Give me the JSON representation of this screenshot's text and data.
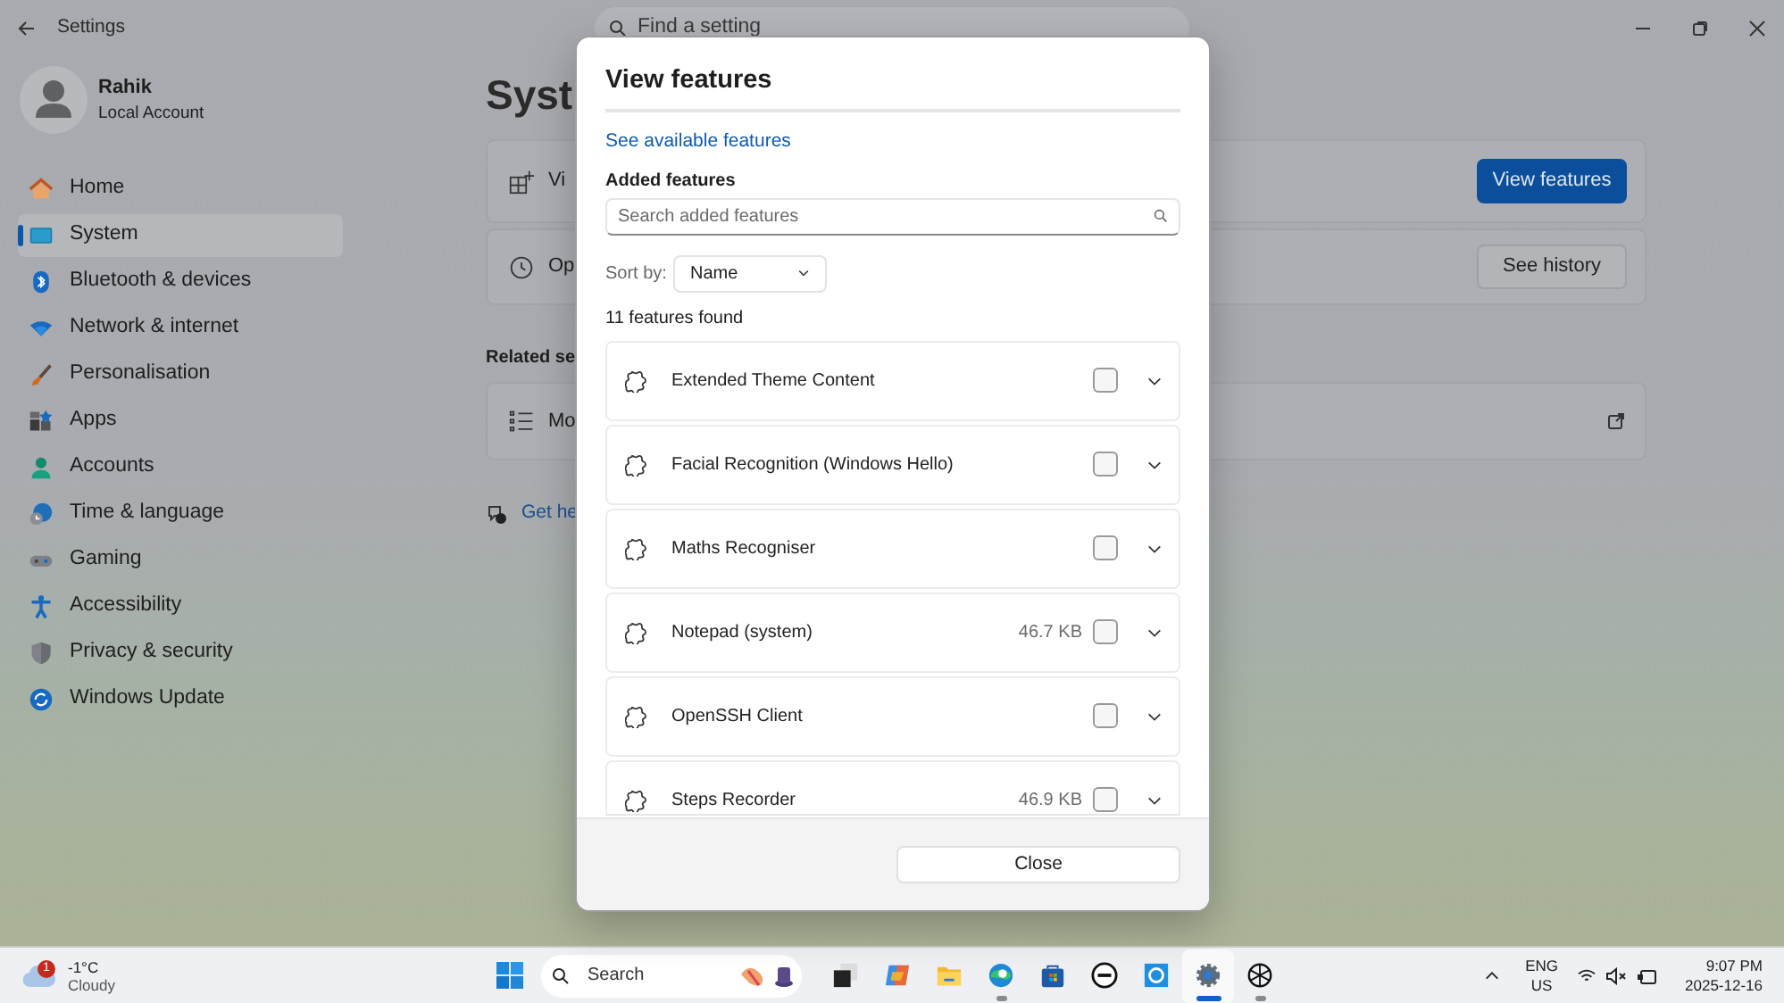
{
  "window": {
    "title": "Settings",
    "search": {
      "placeholder": "Find a setting"
    }
  },
  "account": {
    "name": "Rahik",
    "type": "Local Account"
  },
  "nav": [
    {
      "label": "Home",
      "selected": false
    },
    {
      "label": "System",
      "selected": true
    },
    {
      "label": "Bluetooth & devices",
      "selected": false
    },
    {
      "label": "Network & internet",
      "selected": false
    },
    {
      "label": "Personalisation",
      "selected": false
    },
    {
      "label": "Apps",
      "selected": false
    },
    {
      "label": "Accounts",
      "selected": false
    },
    {
      "label": "Time & language",
      "selected": false
    },
    {
      "label": "Gaming",
      "selected": false
    },
    {
      "label": "Accessibility",
      "selected": false
    },
    {
      "label": "Privacy & security",
      "selected": false
    },
    {
      "label": "Windows Update",
      "selected": false
    }
  ],
  "page": {
    "title": "Syst",
    "cards": [
      {
        "label": "Vi",
        "button": {
          "label": "View features",
          "primary": true
        }
      },
      {
        "label": "Op",
        "button": {
          "label": "See history",
          "primary": false
        }
      }
    ],
    "related_heading": "Related se",
    "related": [
      {
        "label": "Mo"
      }
    ],
    "help_link": "Get he"
  },
  "dialog": {
    "title": "View features",
    "link": "See available features",
    "section_label": "Added features",
    "search": {
      "placeholder": "Search added features"
    },
    "sort_label": "Sort by:",
    "sort_value": "Name",
    "count": "11 features found",
    "features": [
      {
        "name": "Extended Theme Content",
        "checked": false
      },
      {
        "name": "Facial Recognition (Windows Hello)",
        "checked": false
      },
      {
        "name": "Maths Recogniser",
        "checked": false
      },
      {
        "name": "Notepad (system)",
        "size": "46.7 KB",
        "checked": false
      },
      {
        "name": "OpenSSH Client",
        "checked": false
      },
      {
        "name": "Steps Recorder",
        "size": "46.9 KB",
        "checked": false
      }
    ],
    "close": "Close"
  },
  "taskbar": {
    "weather": {
      "temperature": "-1°C",
      "condition": "Cloudy",
      "badge": "1"
    },
    "search": {
      "placeholder": "Search"
    },
    "apps": [
      {
        "running": false,
        "selected": false
      },
      {
        "running": false,
        "selected": false
      },
      {
        "running": false,
        "selected": false
      },
      {
        "running": true,
        "selected": false
      },
      {
        "running": false,
        "selected": false
      },
      {
        "running": false,
        "selected": false
      },
      {
        "running": false,
        "selected": false
      },
      {
        "running": true,
        "selected": true
      },
      {
        "running": true,
        "selected": false
      }
    ],
    "language": "ENG",
    "region": "US",
    "time": "9:07 PM",
    "date": "2025-12-16"
  }
}
